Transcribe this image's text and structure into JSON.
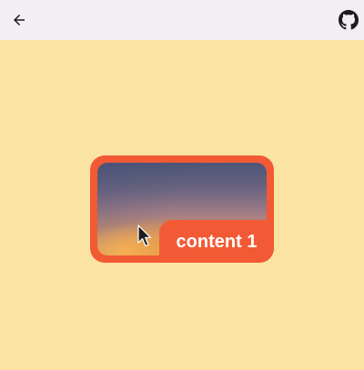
{
  "colors": {
    "background": "#fbe4a3",
    "topbar": "#f3edf4",
    "accent": "#f15a35",
    "icon": "#1d1b20"
  },
  "header": {
    "back_icon": "arrow-left-icon",
    "github_icon": "github-icon"
  },
  "card": {
    "label": "content 1",
    "image": "sunset-sky-image"
  },
  "cursor": "pointer-cursor-icon"
}
